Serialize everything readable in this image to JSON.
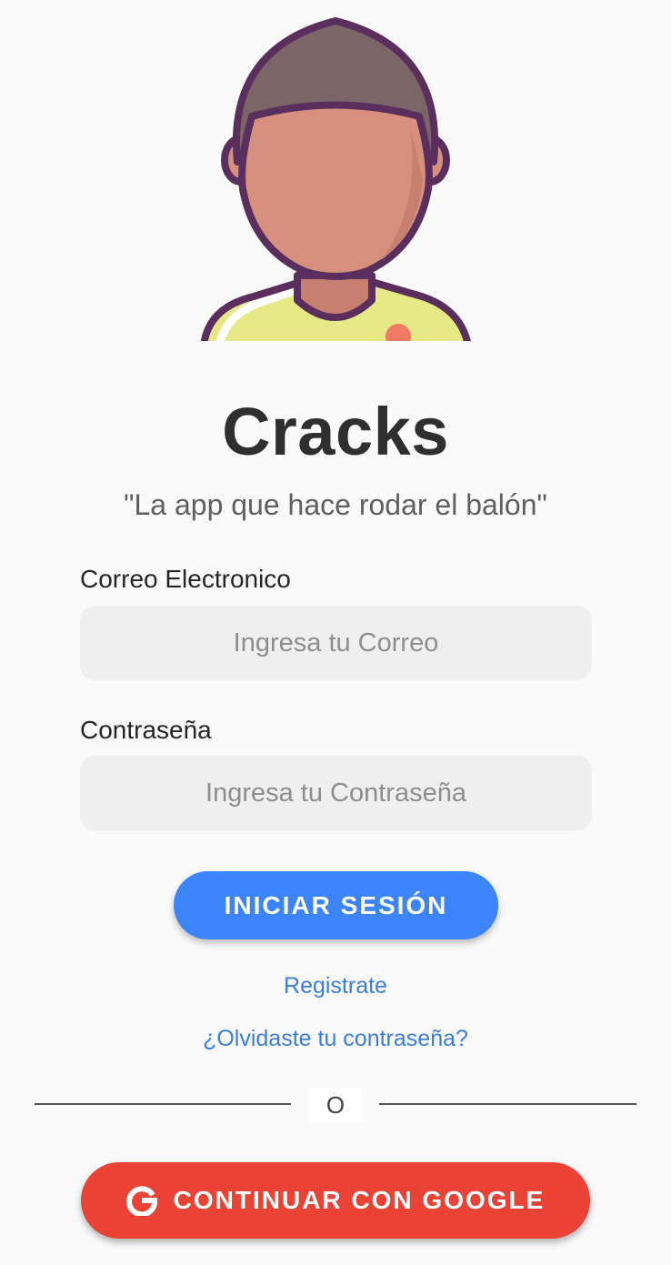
{
  "app": {
    "title": "Cracks",
    "tagline": "\"La app que hace rodar el balón\""
  },
  "form": {
    "email_label": "Correo Electronico",
    "email_placeholder": "Ingresa tu Correo",
    "email_value": "",
    "password_label": "Contraseña",
    "password_placeholder": "Ingresa tu Contraseña",
    "password_value": ""
  },
  "actions": {
    "login_label": "INICIAR SESIÓN",
    "register_label": "Registrate",
    "forgot_label": "¿Olvidaste tu contraseña?",
    "divider_label": "O",
    "google_label": "CONTINUAR CON GOOGLE",
    "google_icon": "google-g-icon"
  },
  "colors": {
    "primary": "#3b84f9",
    "google": "#ea4335",
    "link": "#3b7ddd",
    "input_bg": "#efefef",
    "background": "#fafafb"
  }
}
